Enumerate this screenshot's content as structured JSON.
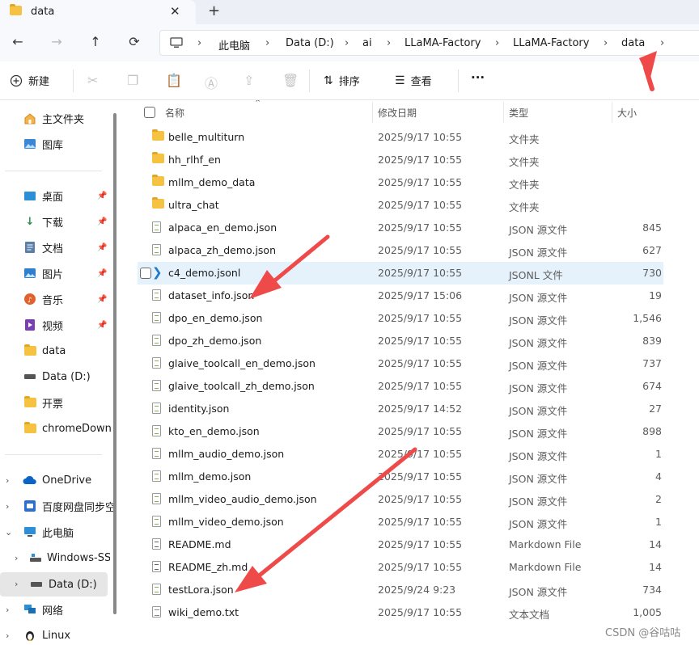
{
  "tab": {
    "title": "data",
    "close": "✕",
    "new_tab": "+"
  },
  "nav": {
    "back": "←",
    "forward": "→",
    "up": "↑",
    "refresh": "⟳"
  },
  "breadcrumbs": [
    "此电脑",
    "Data (D:)",
    "ai",
    "LLaMA-Factory",
    "LLaMA-Factory",
    "data"
  ],
  "toolbar": {
    "new_label": "新建",
    "sort_label": "排序",
    "view_label": "查看",
    "more": "···"
  },
  "sidebar": {
    "quick": [
      "主文件夹",
      "图库"
    ],
    "pinned": [
      "桌面",
      "下载",
      "文档",
      "图片",
      "音乐",
      "视频"
    ],
    "recent": [
      "data",
      "Data (D:)",
      "开票",
      "chromeDown"
    ],
    "tree": [
      "OneDrive",
      "百度网盘同步空",
      "此电脑",
      "Windows-SSD",
      "Data (D:)",
      "网络",
      "Linux"
    ]
  },
  "columns": {
    "name": "名称",
    "modified": "修改日期",
    "type": "类型",
    "size": "大小"
  },
  "files": [
    {
      "name": "belle_multiturn",
      "date": "2025/9/17 10:55",
      "type": "文件夹",
      "size": ""
    },
    {
      "name": "hh_rlhf_en",
      "date": "2025/9/17 10:55",
      "type": "文件夹",
      "size": ""
    },
    {
      "name": "mllm_demo_data",
      "date": "2025/9/17 10:55",
      "type": "文件夹",
      "size": ""
    },
    {
      "name": "ultra_chat",
      "date": "2025/9/17 10:55",
      "type": "文件夹",
      "size": ""
    },
    {
      "name": "alpaca_en_demo.json",
      "date": "2025/9/17 10:55",
      "type": "JSON 源文件",
      "size": "845"
    },
    {
      "name": "alpaca_zh_demo.json",
      "date": "2025/9/17 10:55",
      "type": "JSON 源文件",
      "size": "627"
    },
    {
      "name": "c4_demo.jsonl",
      "date": "2025/9/17 10:55",
      "type": "JSONL 文件",
      "size": "730"
    },
    {
      "name": "dataset_info.json",
      "date": "2025/9/17 15:06",
      "type": "JSON 源文件",
      "size": "19"
    },
    {
      "name": "dpo_en_demo.json",
      "date": "2025/9/17 10:55",
      "type": "JSON 源文件",
      "size": "1,546"
    },
    {
      "name": "dpo_zh_demo.json",
      "date": "2025/9/17 10:55",
      "type": "JSON 源文件",
      "size": "839"
    },
    {
      "name": "glaive_toolcall_en_demo.json",
      "date": "2025/9/17 10:55",
      "type": "JSON 源文件",
      "size": "737"
    },
    {
      "name": "glaive_toolcall_zh_demo.json",
      "date": "2025/9/17 10:55",
      "type": "JSON 源文件",
      "size": "674"
    },
    {
      "name": "identity.json",
      "date": "2025/9/17 14:52",
      "type": "JSON 源文件",
      "size": "27"
    },
    {
      "name": "kto_en_demo.json",
      "date": "2025/9/17 10:55",
      "type": "JSON 源文件",
      "size": "898"
    },
    {
      "name": "mllm_audio_demo.json",
      "date": "2025/9/17 10:55",
      "type": "JSON 源文件",
      "size": "1"
    },
    {
      "name": "mllm_demo.json",
      "date": "2025/9/17 10:55",
      "type": "JSON 源文件",
      "size": "4"
    },
    {
      "name": "mllm_video_audio_demo.json",
      "date": "2025/9/17 10:55",
      "type": "JSON 源文件",
      "size": "2"
    },
    {
      "name": "mllm_video_demo.json",
      "date": "2025/9/17 10:55",
      "type": "JSON 源文件",
      "size": "1"
    },
    {
      "name": "README.md",
      "date": "2025/9/17 10:55",
      "type": "Markdown File",
      "size": "14"
    },
    {
      "name": "README_zh.md",
      "date": "2025/9/17 10:55",
      "type": "Markdown File",
      "size": "14"
    },
    {
      "name": "testLora.json",
      "date": "2025/9/24 9:23",
      "type": "JSON 源文件",
      "size": "734"
    },
    {
      "name": "wiki_demo.txt",
      "date": "2025/9/17 10:55",
      "type": "文本文档",
      "size": "1,005"
    }
  ],
  "watermark": "CSDN @谷咕咕",
  "colors": {
    "selection": "#e5f1fb",
    "folder": "#f5c242",
    "annotation_arrow": "#ef4a4a",
    "accent": "#0067c0"
  }
}
